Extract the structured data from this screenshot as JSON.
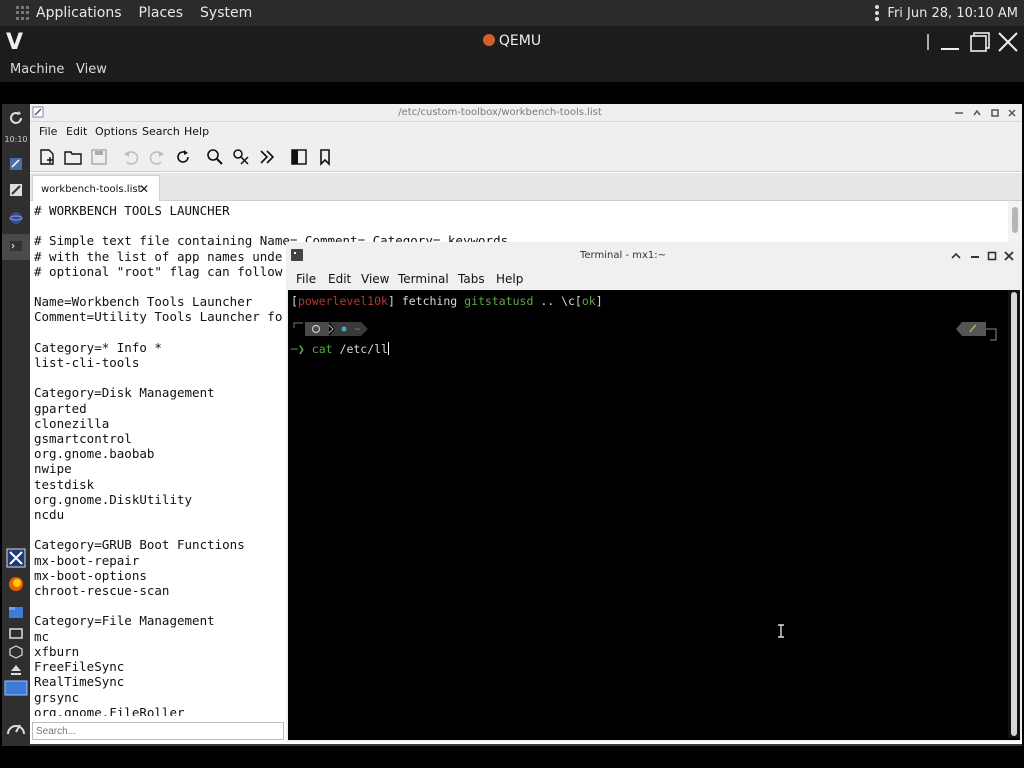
{
  "host_panel": {
    "menus": [
      "Applications",
      "Places",
      "System"
    ],
    "clock": "Fri Jun 28, 10:10 AM"
  },
  "qemu": {
    "title": "QEMU",
    "menus": [
      "Machine",
      "View"
    ]
  },
  "guest_panel": {
    "time": "10:10"
  },
  "editor": {
    "title": "/etc/custom-toolbox/workbench-tools.list",
    "menus": [
      "File",
      "Edit",
      "Options",
      "Search",
      "Help"
    ],
    "tab_label": "workbench-tools.list",
    "search_placeholder": "Search...",
    "lines": [
      "# WORKBENCH TOOLS LAUNCHER",
      "",
      "# Simple text file containing Name= Comment= Category= keywords",
      "# with the list of app names unde",
      "# optional \"root\" flag can follow",
      "",
      "Name=Workbench Tools Launcher",
      "Comment=Utility Tools Launcher fo",
      "",
      "Category=* Info *",
      "list-cli-tools",
      "",
      "Category=Disk Management",
      "gparted",
      "clonezilla",
      "gsmartcontrol",
      "org.gnome.baobab",
      "nwipe",
      "testdisk",
      "org.gnome.DiskUtility",
      "ncdu",
      "",
      "Category=GRUB Boot Functions",
      "mx-boot-repair",
      "mx-boot-options",
      "chroot-rescue-scan",
      "",
      "Category=File Management",
      "mc",
      "xfburn",
      "FreeFileSync",
      "RealTimeSync",
      "grsync",
      "org.gnome.FileRoller"
    ]
  },
  "terminal": {
    "title": "Terminal - mx1:~",
    "menus": [
      "File",
      "Edit",
      "View",
      "Terminal",
      "Tabs",
      "Help"
    ],
    "line1": {
      "open_bracket": "[",
      "powerlevel": "powerlevel10k",
      "close_bracket": "]",
      "fetching": " fetching ",
      "gitstatusd": "gitstatusd",
      "dots": " .. \\c[",
      "ok": "ok",
      "end": "]"
    },
    "prompt_arrow": "─❯",
    "command": "cat",
    "argument": "/etc/ll",
    "colors": {
      "red": "#b03a2e",
      "green": "#5fa84a",
      "cmd_green": "#4fae3a"
    }
  }
}
